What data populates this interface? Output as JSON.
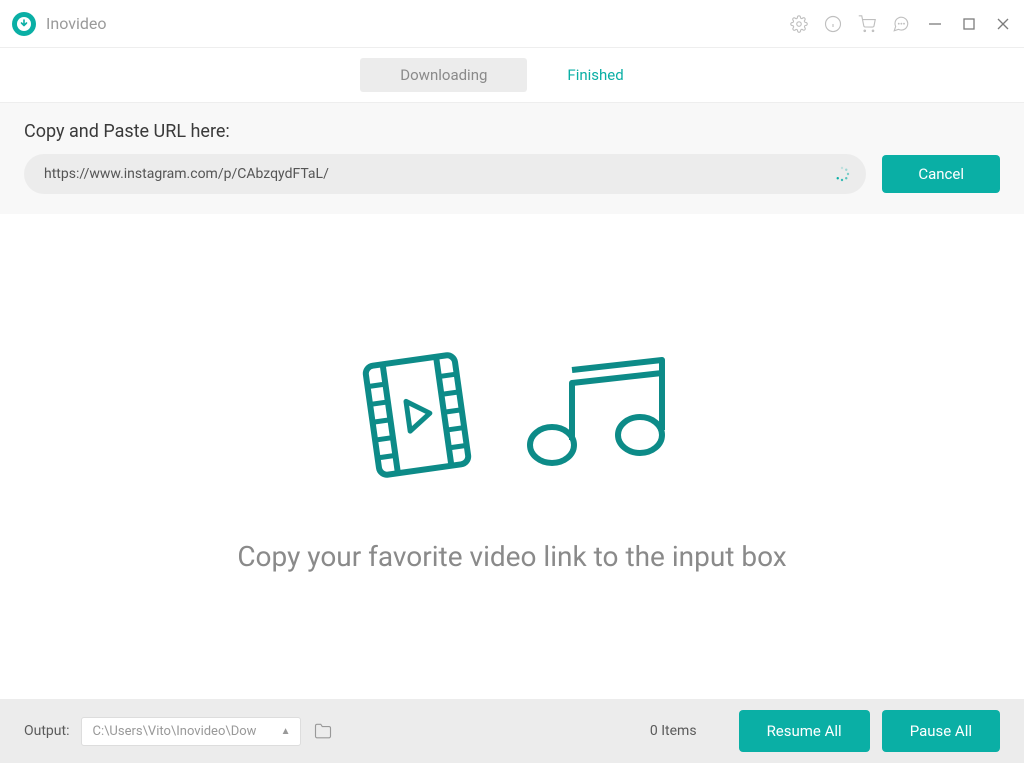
{
  "app": {
    "name": "Inovideo"
  },
  "tabs": {
    "downloading": "Downloading",
    "finished": "Finished"
  },
  "urlSection": {
    "label": "Copy and Paste URL here:",
    "value": "https://www.instagram.com/p/CAbzqydFTaL/",
    "cancelLabel": "Cancel"
  },
  "empty": {
    "message": "Copy your favorite video link to the input box"
  },
  "footer": {
    "outputLabel": "Output:",
    "outputPath": "C:\\Users\\Vito\\Inovideo\\Dow",
    "itemsCount": "0 Items",
    "resumeLabel": "Resume All",
    "pauseLabel": "Pause All"
  }
}
